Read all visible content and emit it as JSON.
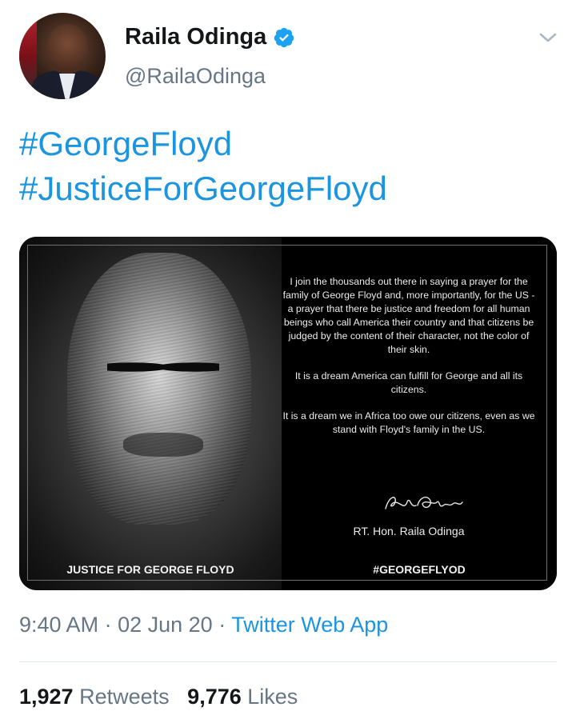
{
  "tweet": {
    "author": {
      "name": "Raila Odinga",
      "handle": "@RailaOdinga",
      "verified_icon": "verified-badge-icon"
    },
    "hashtags": [
      "#GeorgeFloyd",
      "#JusticeForGeorgeFloyd"
    ],
    "media": {
      "quote_paragraphs": [
        "I join the thousands out there in saying a prayer for the family of George Floyd and, more importantly, for the US -a prayer that there be justice and freedom for all human beings who call America their country and that citizens be judged by the content of their character, not the color of their skin.",
        "It is a dream America can fulfill for George and all its citizens.",
        "It is a dream we in Africa too owe our citizens, even as we stand with Floyd's family in the US."
      ],
      "signature_name": "RT. Hon. Raila Odinga",
      "caption_left": "JUSTICE FOR GEORGE FLOYD",
      "caption_right": "#GEORGEFLYOD"
    },
    "meta": {
      "time": "9:40 AM",
      "date": "02 Jun 20",
      "source": "Twitter Web App"
    },
    "stats": {
      "retweets_count": "1,927",
      "retweets_label": "Retweets",
      "likes_count": "9,776",
      "likes_label": "Likes"
    }
  },
  "colors": {
    "link": "#1b95e0",
    "secondary_text": "#657786",
    "primary_text": "#14171a"
  }
}
